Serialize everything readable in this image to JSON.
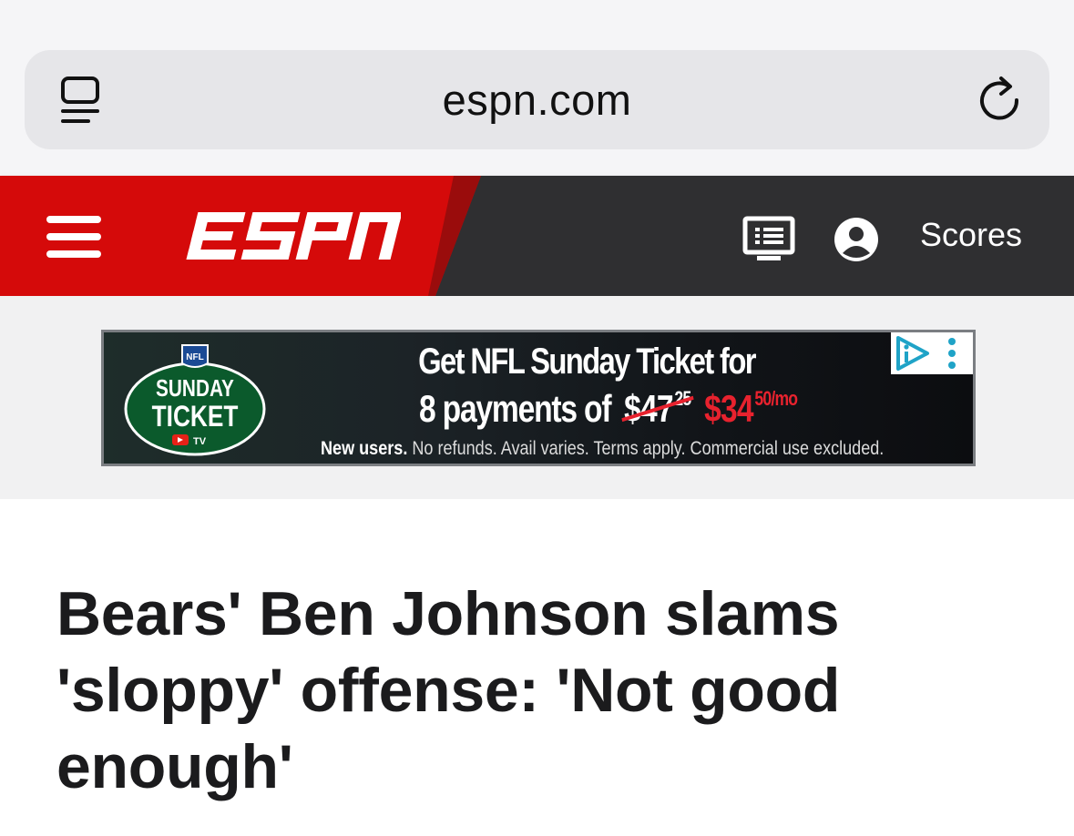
{
  "browser": {
    "url": "espn.com",
    "tab_icon": "tab-overview-icon",
    "reload_icon": "reload-icon"
  },
  "nav": {
    "menu_icon": "hamburger-menu-icon",
    "logo_text": "ESPN",
    "tv_icon": "watch-tv-icon",
    "user_icon": "account-icon",
    "scores_label": "Scores",
    "colors": {
      "red": "#d50a0a",
      "dark": "#2f2f31"
    }
  },
  "ad": {
    "logo_text": [
      "NFL",
      "SUNDAY",
      "TICKET",
      "TV"
    ],
    "headline": "Get NFL Sunday Ticket for",
    "price_prefix": "8 payments of",
    "old_price": "$47",
    "old_price_cents": "25",
    "new_price": "$34",
    "new_price_suffix": "50/mo",
    "fine_print_bold": "New users.",
    "fine_print": " No refunds. Avail varies. Terms apply. Commercial use excluded.",
    "adchoices_icon": "adchoices-icon",
    "ad_menu_icon": "more-vertical-icon"
  },
  "article": {
    "headline": "Bears' Ben Johnson slams 'sloppy' offense: 'Not good enough'"
  }
}
